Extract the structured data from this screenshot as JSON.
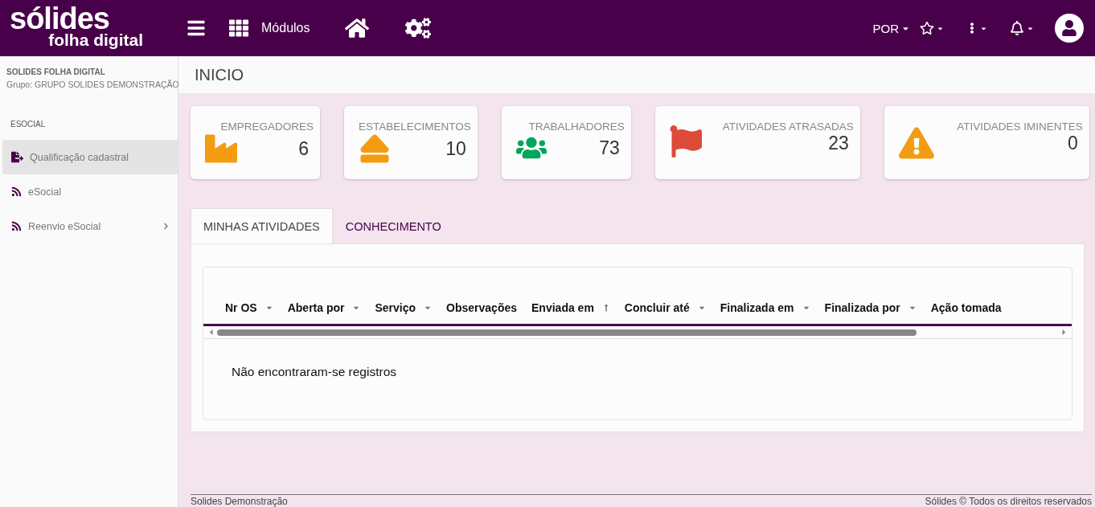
{
  "header": {
    "logo": "sólides",
    "logo_sub": "folha digital",
    "modules": "Módulos",
    "language": "POR"
  },
  "sidebar": {
    "company": "SOLIDES FOLHA DIGITAL",
    "group": "Grupo: GRUPO SOLIDES DEMONSTRAÇÃO",
    "section": "ESOCIAL",
    "items": [
      {
        "label": "Qualificação cadastral",
        "kind": "document",
        "selected": true,
        "expandable": false
      },
      {
        "label": "eSocial",
        "kind": "feed",
        "selected": false,
        "expandable": false
      },
      {
        "label": "Reenvio eSocial",
        "kind": "feed",
        "selected": false,
        "expandable": true
      }
    ]
  },
  "page": {
    "title": "INICIO"
  },
  "cards": [
    {
      "label": "EMPREGADORES",
      "value": "6",
      "kind": "factory",
      "color": "#f39c12"
    },
    {
      "label": "ESTABELECIMENTOS",
      "value": "10",
      "kind": "eject",
      "color": "#f39c12"
    },
    {
      "label": "TRABALHADORES",
      "value": "73",
      "kind": "users",
      "color": "#00a65a"
    },
    {
      "label": "ATIVIDADES ATRASADAS",
      "value": "23",
      "kind": "flag",
      "color": "#dd4b39"
    },
    {
      "label": "ATIVIDADES IMINENTES",
      "value": "0",
      "kind": "warning",
      "color": "#f39c12"
    }
  ],
  "tabs": [
    {
      "label": "MINHAS ATIVIDADES",
      "selected": true
    },
    {
      "label": "CONHECIMENTO",
      "selected": false
    }
  ],
  "table": {
    "columns": [
      {
        "label": "Nr OS",
        "kind": "menu"
      },
      {
        "label": "Aberta por",
        "kind": "menu"
      },
      {
        "label": "Serviço",
        "kind": "menu"
      },
      {
        "label": "Observações",
        "kind": "plain"
      },
      {
        "label": "Enviada em",
        "kind": "sorted"
      },
      {
        "label": "Concluir até",
        "kind": "menu"
      },
      {
        "label": "Finalizada em",
        "kind": "menu"
      },
      {
        "label": "Finalizada por",
        "kind": "menu"
      },
      {
        "label": "Ação tomada",
        "kind": "plain"
      }
    ],
    "empty_message": "Não encontraram-se registros"
  },
  "footer": {
    "left": "Solides Demonstração",
    "right": "Sólides © Todos os direitos reservados"
  }
}
